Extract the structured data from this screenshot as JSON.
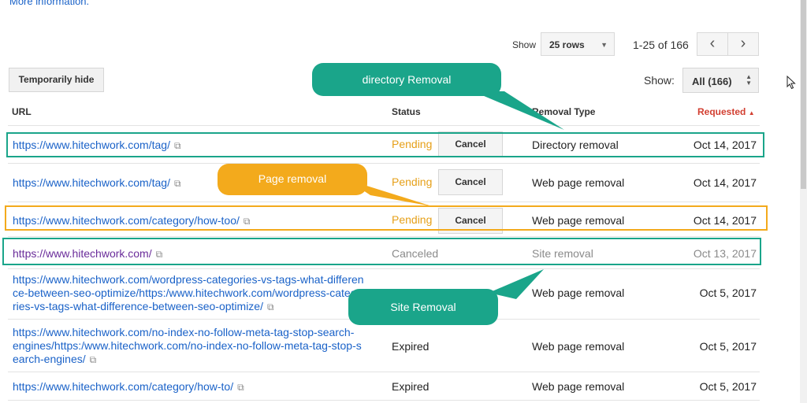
{
  "top": {
    "more_info": "More information."
  },
  "pager": {
    "show_label": "Show",
    "rows_value": "25 rows",
    "range_text": "1-25 of 166",
    "prev_icon": "chevron-left-icon",
    "next_icon": "chevron-right-icon"
  },
  "toolbar": {
    "hide_label": "Temporarily hide",
    "show_label": "Show:",
    "filter_value": "All (166)"
  },
  "table": {
    "headers": {
      "url": "URL",
      "status": "Status",
      "type": "Removal Type",
      "requested": "Requested"
    },
    "rows": [
      {
        "url_lines": [
          "https://www.hitechwork.com/tag/"
        ],
        "status": "Pending",
        "cancel": "Cancel",
        "type": "Directory removal",
        "date": "Oct 14, 2017"
      },
      {
        "url_lines": [
          "https://www.hitechwork.com/tag/"
        ],
        "status": "Pending",
        "cancel": "Cancel",
        "type": "Web page removal",
        "date": "Oct 14, 2017"
      },
      {
        "url_lines": [
          "https://www.hitechwork.com/category/how-too/"
        ],
        "status": "Pending",
        "cancel": "Cancel",
        "type": "Web page removal",
        "date": "Oct 14, 2017"
      },
      {
        "url_lines": [
          "https://www.hitechwork.com/"
        ],
        "status": "Canceled",
        "type": "Site removal",
        "date": "Oct 13, 2017"
      },
      {
        "url_lines": [
          "https://www.hitechwork.com/wordpress-categories-vs-tags-what-differen",
          "ce-between-seo-optimize/https:/www.hitechwork.com/wordpress-catego",
          "ries-vs-tags-what-difference-between-seo-optimize/"
        ],
        "status": "",
        "type": "Web page removal",
        "date": "Oct 5, 2017"
      },
      {
        "url_lines": [
          "https://www.hitechwork.com/no-index-no-follow-meta-tag-stop-search-",
          "engines/https:/www.hitechwork.com/no-index-no-follow-meta-tag-stop-s",
          "earch-engines/"
        ],
        "status": "Expired",
        "type": "Web page removal",
        "date": "Oct 5, 2017"
      },
      {
        "url_lines": [
          "https://www.hitechwork.com/category/how-to/"
        ],
        "status": "Expired",
        "type": "Web page removal",
        "date": "Oct 5, 2017"
      }
    ]
  },
  "callouts": {
    "directory": "directory Removal",
    "page": "Page removal",
    "site": "Site Removal"
  },
  "colors": {
    "teal": "#1aa58a",
    "orange": "#f3aa1c",
    "pending": "#e6a019",
    "link": "#1a62c8",
    "sort_accent": "#d23f31"
  }
}
